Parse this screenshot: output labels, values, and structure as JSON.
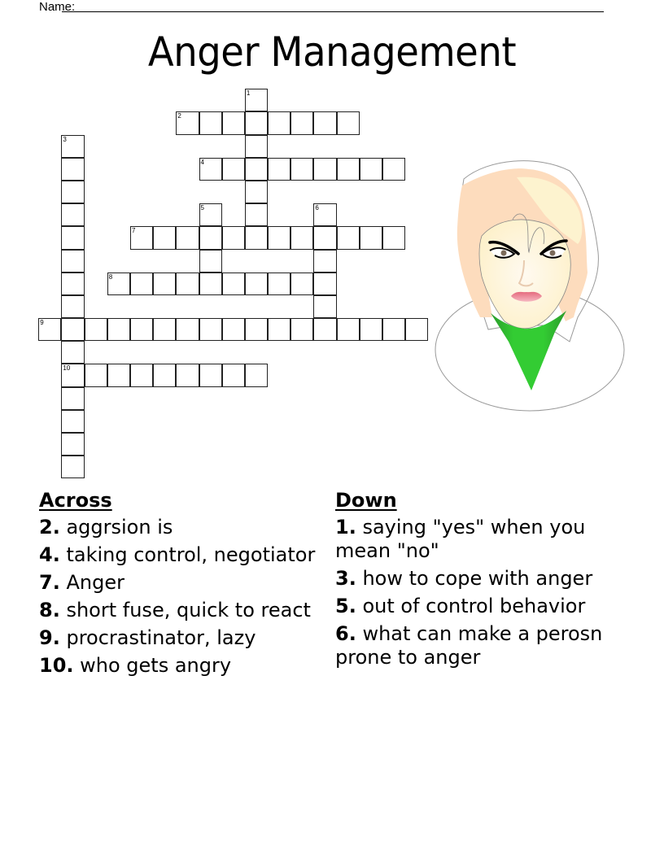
{
  "header": {
    "name_label": "Name:",
    "title": "Anger Management"
  },
  "grid": {
    "cols": 17,
    "rows": 17,
    "entries": [
      {
        "number": 1,
        "direction": "down",
        "row": 0,
        "col": 9,
        "length": 7
      },
      {
        "number": 2,
        "direction": "across",
        "row": 1,
        "col": 6,
        "length": 8
      },
      {
        "number": 3,
        "direction": "down",
        "row": 2,
        "col": 1,
        "length": 15
      },
      {
        "number": 4,
        "direction": "across",
        "row": 3,
        "col": 7,
        "length": 9
      },
      {
        "number": 5,
        "direction": "down",
        "row": 5,
        "col": 7,
        "length": 4
      },
      {
        "number": 6,
        "direction": "down",
        "row": 5,
        "col": 12,
        "length": 6
      },
      {
        "number": 7,
        "direction": "across",
        "row": 6,
        "col": 4,
        "length": 12
      },
      {
        "number": 8,
        "direction": "across",
        "row": 8,
        "col": 3,
        "length": 10
      },
      {
        "number": 9,
        "direction": "across",
        "row": 10,
        "col": 0,
        "length": 17
      },
      {
        "number": 10,
        "direction": "across",
        "row": 12,
        "col": 1,
        "length": 9
      }
    ]
  },
  "illustration": {
    "icon": "angry-woman-illustration",
    "colors": {
      "hair": "#fddcbd",
      "hair_highlight": "#fdf3cf",
      "skin": "#fdf6e6",
      "shirt": "#33cc33",
      "lips": "#e97a8a",
      "outline": "#888888"
    }
  },
  "clues": {
    "across_heading": "Across",
    "down_heading": "Down",
    "across": [
      {
        "number": "2.",
        "text": "aggrsion is"
      },
      {
        "number": "4.",
        "text": "taking control, negotiator"
      },
      {
        "number": "7.",
        "text": "Anger"
      },
      {
        "number": "8.",
        "text": "short fuse, quick to react"
      },
      {
        "number": "9.",
        "text": "procrastinator, lazy"
      },
      {
        "number": "10.",
        "text": "who gets angry"
      }
    ],
    "down": [
      {
        "number": "1.",
        "text": "saying \"yes\" when you mean \"no\""
      },
      {
        "number": "3.",
        "text": "how to cope with anger"
      },
      {
        "number": "5.",
        "text": "out of control behavior"
      },
      {
        "number": "6.",
        "text": "what can make a perosn prone to anger"
      }
    ]
  }
}
